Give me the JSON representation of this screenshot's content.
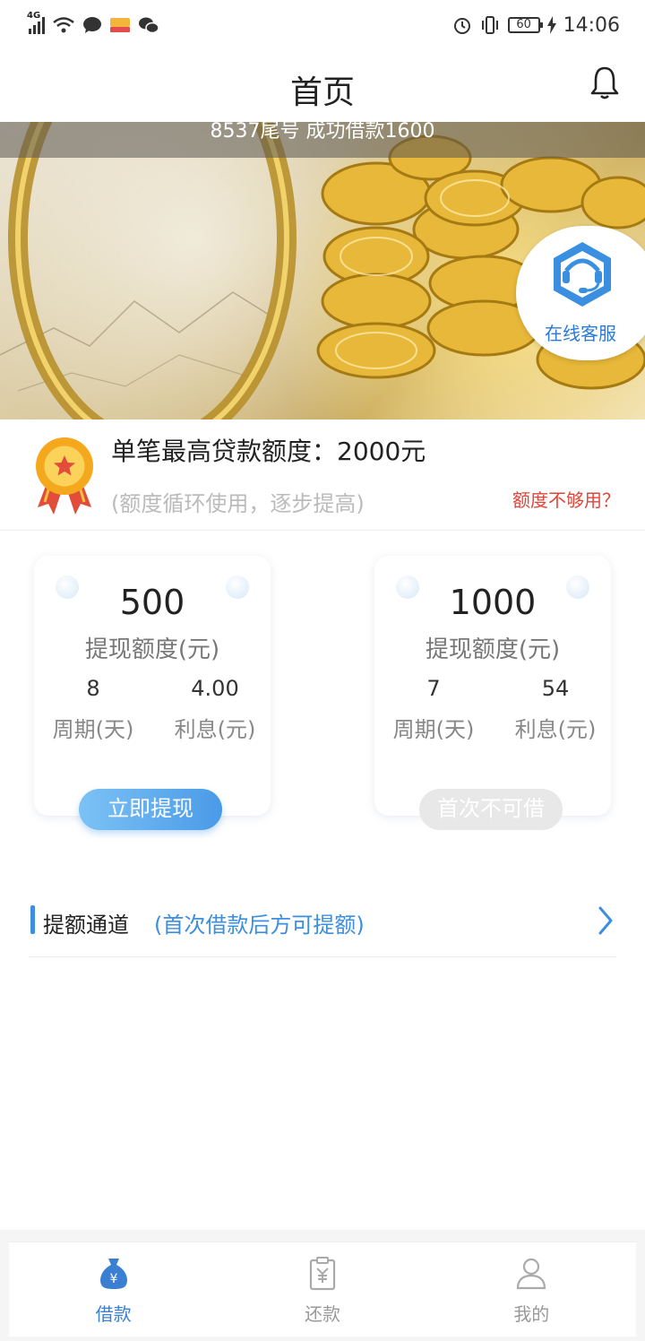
{
  "status_bar": {
    "network": "4G",
    "battery": "60",
    "time": "14:06"
  },
  "header": {
    "title": "首页"
  },
  "banner": {
    "ticker_text": "8537尾号 成功借款1600",
    "service_label": "在线客服"
  },
  "limit": {
    "title": "单笔最高贷款额度：2000元",
    "subtitle": "(额度循环使用，逐步提高)",
    "link": "额度不够用？"
  },
  "cards": [
    {
      "amount": "500",
      "amount_label": "提现额度(元)",
      "period_value": "8",
      "period_label": "周期(天)",
      "interest_value": "4.00",
      "interest_label": "利息(元)",
      "button_label": "立即提现"
    },
    {
      "amount": "1000",
      "amount_label": "提现额度(元)",
      "period_value": "7",
      "period_label": "周期(天)",
      "interest_value": "54",
      "interest_label": "利息(元)",
      "button_label": "首次不可借"
    }
  ],
  "channel": {
    "title": "提额通道",
    "note": "(首次借款后方可提额)"
  },
  "bottom_nav": {
    "items": [
      {
        "label": "借款",
        "icon": "money-bag-icon",
        "active": true
      },
      {
        "label": "还款",
        "icon": "repay-clipboard-icon",
        "active": false
      },
      {
        "label": "我的",
        "icon": "user-icon",
        "active": false
      }
    ]
  },
  "colors": {
    "accent": "#3b8ee0",
    "warning": "#e0453a",
    "nav_active": "#3b7fd2"
  }
}
